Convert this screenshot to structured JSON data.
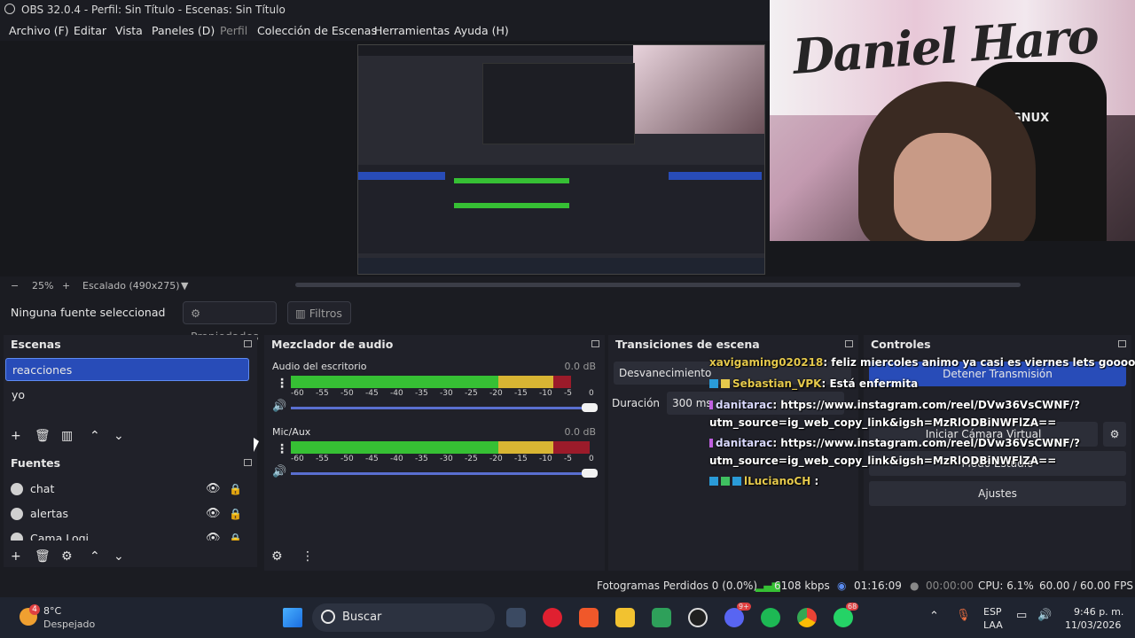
{
  "window": {
    "title": "OBS 32.0.4 - Perfil: Sin Título - Escenas: Sin Título"
  },
  "menu": [
    "Archivo (F)",
    "Editar",
    "Vista",
    "Paneles (D)",
    "Perfil",
    "Colección de Escenas",
    "Herramientas",
    "Ayuda (H)"
  ],
  "webcam": {
    "graffiti": "Daniel Haro",
    "chair_brand": "MAGNUX"
  },
  "preview": {
    "zoom": "25%",
    "scale": "Escalado (490x275)"
  },
  "source_bar": {
    "none_selected": "Ninguna fuente seleccionad",
    "properties": "Propiedades",
    "filters": "Filtros"
  },
  "scenes": {
    "title": "Escenas",
    "items": [
      "reacciones",
      "yo"
    ],
    "selected": "reacciones"
  },
  "sources": {
    "title": "Fuentes",
    "items": [
      {
        "label": "chat"
      },
      {
        "label": "alertas"
      },
      {
        "label": "Cama Logi"
      }
    ]
  },
  "mixer": {
    "title": "Mezclador de audio",
    "tracks": [
      {
        "name": "Audio del escritorio",
        "db": "0.0 dB",
        "level": 0.92
      },
      {
        "name": "Mic/Aux",
        "db": "0.0 dB",
        "level": 0.98
      }
    ],
    "ticks": [
      "-60",
      "-55",
      "-50",
      "-45",
      "-40",
      "-35",
      "-30",
      "-25",
      "-20",
      "-15",
      "-10",
      "-5",
      "0"
    ]
  },
  "transitions": {
    "title": "Transiciones de escena",
    "type": "Desvanecimiento",
    "duration_label": "Duración",
    "duration": "300 ms"
  },
  "controls": {
    "title": "Controles",
    "stop_stream": "Detener Transmisión",
    "virtual_cam": "Iniciar Cámara Virtual",
    "studio_mode": "Modo Estudio",
    "settings": "Ajustes"
  },
  "chat": [
    {
      "user": "xavigaming020218",
      "msg": ": feliz miercoles animo ya casi es viernes lets goooo"
    },
    {
      "user": "Sebastian_VPK",
      "msg": ": Está enfermita"
    },
    {
      "user": "danitarac",
      "msg": ": https://www.instagram.com/reel/DVw36VsCWNF/?"
    },
    {
      "user": "",
      "msg": "utm_source=ig_web_copy_link&igsh=MzRlODBiNWFlZA=="
    },
    {
      "user": "danitarac",
      "msg": ": https://www.instagram.com/reel/DVw36VsCWNF/?"
    },
    {
      "user": "",
      "msg": "utm_source=ig_web_copy_link&igsh=MzRlODBiNWFlZA=="
    },
    {
      "user": "lLucianoCH",
      "msg": " :"
    }
  ],
  "status": {
    "dropped": "Fotogramas Perdidos 0 (0.0%)",
    "bitrate": "6108 kbps",
    "stream_time": "01:16:09",
    "rec_time": "00:00:00",
    "cpu": "CPU: 6.1%",
    "fps": "60.00 / 60.00 FPS"
  },
  "taskbar": {
    "weather_temp": "8°C",
    "weather_desc": "Despejado",
    "weather_badge": "4",
    "search": "Buscar",
    "lang": "ESP",
    "lang2": "LAA",
    "time": "9:46 p. m.",
    "date": "11/03/2026",
    "discord_badge": "9+",
    "whatsapp_badge": "68"
  },
  "colors": {
    "accent": "#284cb8",
    "meter_green": "#36c034",
    "meter_yellow": "#d8b533",
    "meter_red": "#9b1b2a"
  }
}
